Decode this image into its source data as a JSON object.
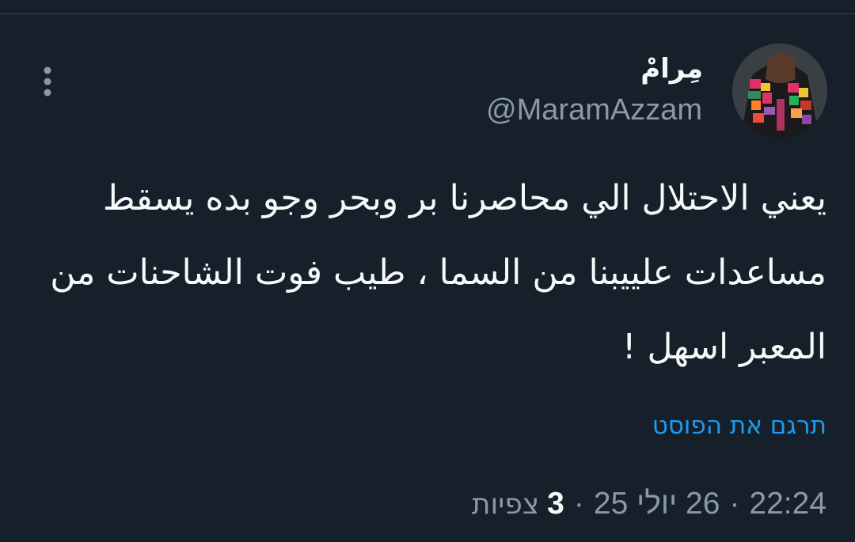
{
  "tweet": {
    "author": {
      "display_name": "مِرامْ",
      "handle": "@MaramAzzam",
      "avatar_icon": "embroidered-shawl-avatar-icon"
    },
    "more_icon": "vertical-dots-icon",
    "text_lines": [
      "يعني الاحتلال الي محاصرنا بر وبحر وجو بده يسقط",
      "مساعدات علييبنا من السما ، طيب فوت الشاحنات من",
      "المعبر اسهل !"
    ],
    "translate_label": "תרגם את הפוסט",
    "meta": {
      "time": "22:24",
      "date": "26 יולי 25",
      "separator": "·",
      "views_count": "3",
      "views_label": "צפיות"
    }
  },
  "colors": {
    "background": "#15202b",
    "primary_text": "#f7f9f9",
    "secondary_text": "#8b98a5",
    "link": "#1d9bf0",
    "divider": "#38444d"
  }
}
